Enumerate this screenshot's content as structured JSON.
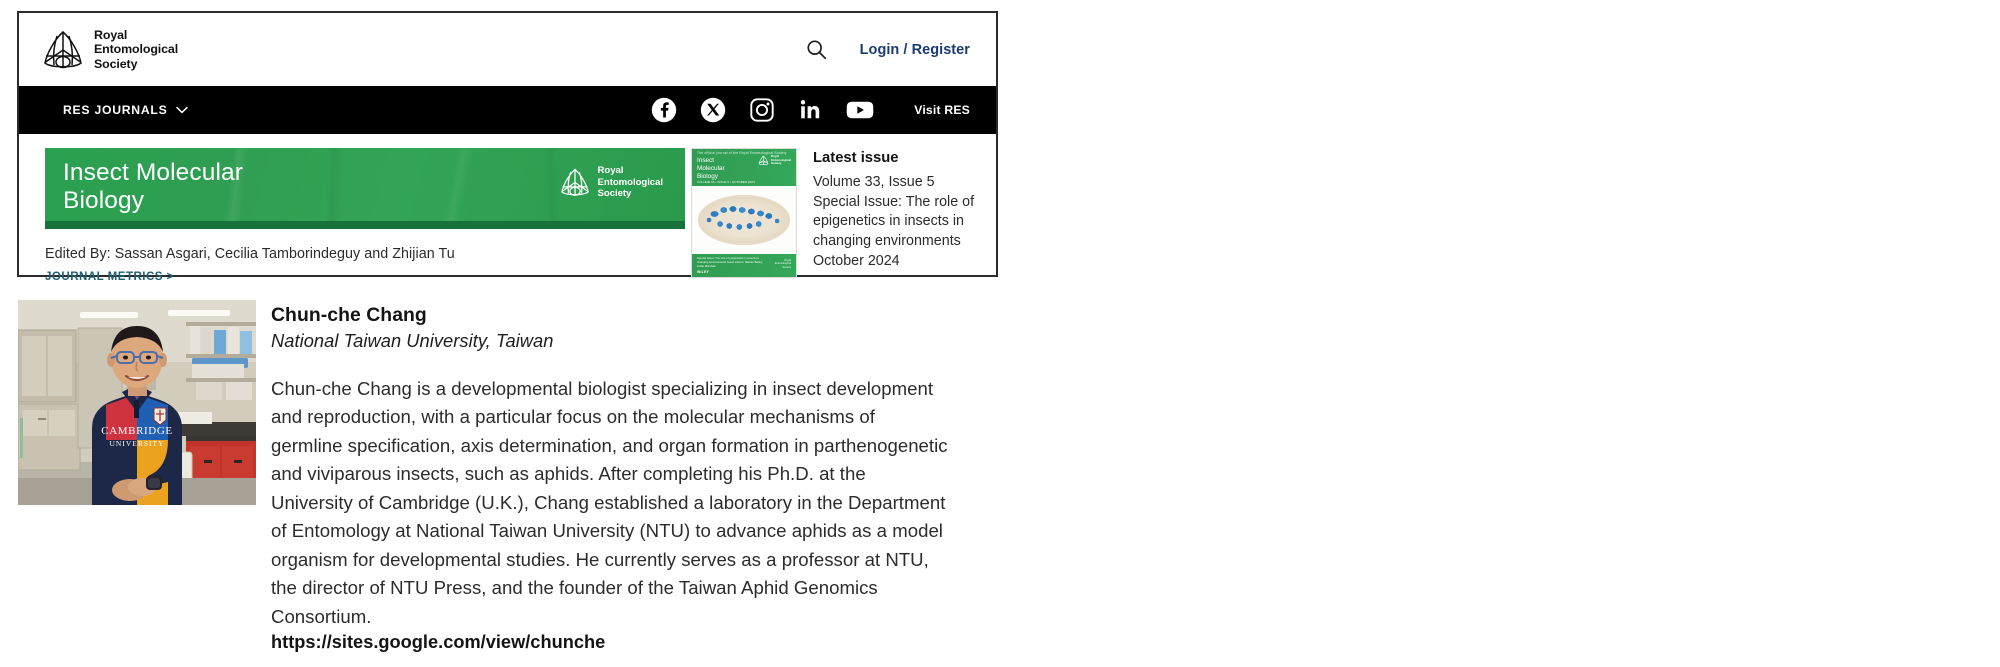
{
  "header": {
    "logo": {
      "icon": "res-moth-logo-icon",
      "wordmark": "Royal\nEntomological\nSociety"
    },
    "search_icon": "search-icon",
    "login_label": "Login / Register"
  },
  "nav": {
    "journals_label": "RES JOURNALS",
    "chevron_icon": "chevron-down-icon",
    "social": [
      {
        "name": "facebook-icon",
        "label": "Facebook"
      },
      {
        "name": "x-twitter-icon",
        "label": "X"
      },
      {
        "name": "instagram-icon",
        "label": "Instagram"
      },
      {
        "name": "linkedin-icon",
        "label": "LinkedIn"
      },
      {
        "name": "youtube-icon",
        "label": "YouTube"
      }
    ],
    "visit_label": "Visit RES"
  },
  "journal": {
    "banner_title": "Insect Molecular\nBiology",
    "banner_logo_words": "Royal\nEntomological\nSociety",
    "edited_by": "Edited By: Sassan Asgari, Cecilia Tamborindeguy and Zhijian Tu",
    "metrics_label": "JOURNAL METRICS >",
    "banner_green": "#2f9e52",
    "banner_green_dark": "#17713a"
  },
  "latest_issue": {
    "heading": "Latest issue",
    "volume": "Volume 33, Issue 5",
    "special_issue": "Special Issue: The role of epigenetics in insects in changing environments",
    "date": "October 2024",
    "cover": {
      "eyebrow": "The official journal of the Royal Entomological Society",
      "title": "Insect\nMolecular\nBiology",
      "logo_words": "Royal\nEntomological\nSociety",
      "volume_line": "VOLUME 33 • ISSUE 5 • OCTOBER 2024",
      "caption": "Special Issue: The role of epigenetics in insects in changing environments\nGuest editors: Nathan Bailey, Hollie Marshall",
      "right_block": "Royal\nEntomological\nSociety",
      "publisher": "WILEY"
    }
  },
  "profile": {
    "photo_alt": "Chun-che Chang standing in a laboratory wearing a Cambridge University polo shirt",
    "name": "Chun-che Chang",
    "affiliation": "National Taiwan University, Taiwan",
    "bio": "Chun-che Chang is a developmental biologist specializing in insect development and reproduction, with a particular focus on the molecular mechanisms of germline specification, axis determination, and organ formation in parthenogenetic and viviparous insects, such as aphids. After completing his Ph.D. at the University of Cambridge (U.K.), Chang established a laboratory in the Department of Entomology at National Taiwan University (NTU) to advance aphids as a model organism for developmental studies. He currently serves as a professor at NTU, the director of NTU Press, and the founder of the Taiwan Aphid Genomics Consortium.",
    "url": "https://sites.google.com/view/chunche",
    "shirt_text": "CAMBRIDGE\nUNIVERSITY"
  }
}
